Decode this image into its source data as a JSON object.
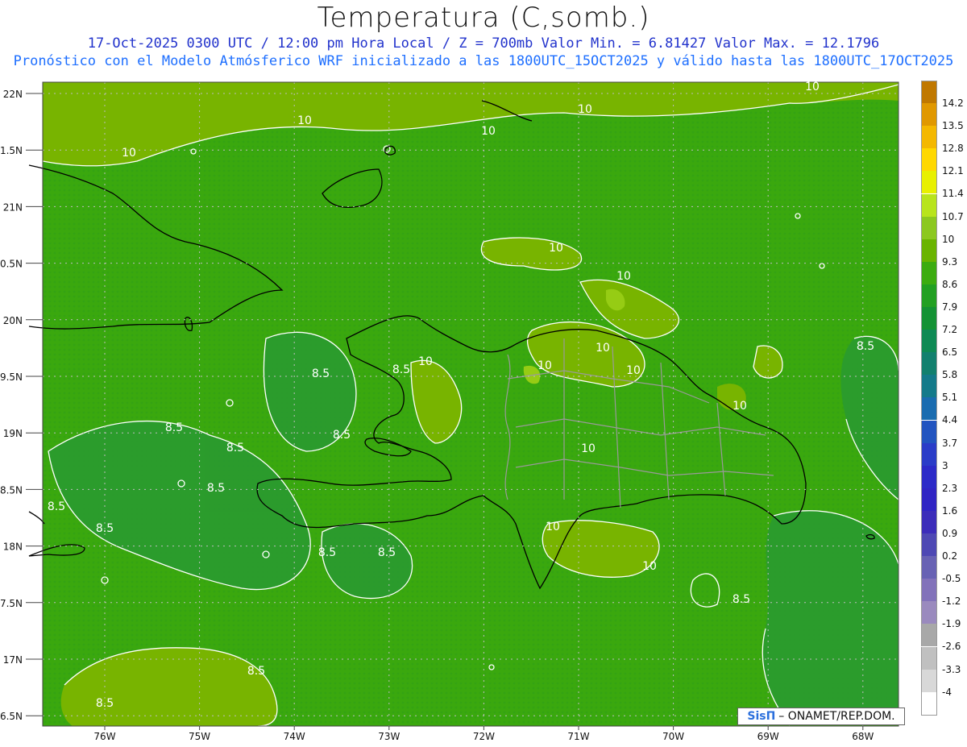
{
  "header": {
    "title": "Temperatura (C,somb.)",
    "line1": "17-Oct-2025  0300 UTC / 12:00 pm Hora Local / Z = 700mb   Valor Min. = 6.81427  Valor Max. = 12.1796",
    "line2": "Pronóstico con el Modelo Atmósferico WRF inicializado a las 1800UTC_15OCT2025 y válido hasta las  1800UTC_17OCT2025"
  },
  "axes": {
    "lat_labels": [
      "22N",
      "1.5N",
      "21N",
      "0.5N",
      "20N",
      "9.5N",
      "19N",
      "8.5N",
      "18N",
      "7.5N",
      "17N",
      "6.5N"
    ],
    "lon_labels": [
      "76W",
      "75W",
      "74W",
      "73W",
      "72W",
      "71W",
      "70W",
      "69W",
      "68W"
    ]
  },
  "colorbar": {
    "levels": [
      "14.2",
      "13.5",
      "12.8",
      "12.1",
      "11.4",
      "10.7",
      "10",
      "9.3",
      "8.6",
      "7.9",
      "7.2",
      "6.5",
      "5.8",
      "5.1",
      "4.4",
      "3.7",
      "3",
      "2.3",
      "1.6",
      "0.9",
      "0.2",
      "-0.5",
      "-1.2",
      "-1.9",
      "-2.6",
      "-3.3",
      "-4"
    ],
    "colors": [
      "#c07800",
      "#e09800",
      "#f4b800",
      "#ffd800",
      "#e8f000",
      "#b8e41c",
      "#8cc820",
      "#6ab400",
      "#3cac10",
      "#22a022",
      "#149234",
      "#0e8a54",
      "#12806e",
      "#147a8a",
      "#1a6cb0",
      "#2254c0",
      "#2a3cc8",
      "#2c2ac8",
      "#3024c4",
      "#3c2cba",
      "#4e48b4",
      "#6862b4",
      "#8272ba",
      "#9a8abe",
      "#a8a8a8",
      "#c0c0c0",
      "#d8d8d8",
      "#ffffff"
    ]
  },
  "contour_labels": [
    "10",
    "10",
    "10",
    "10",
    "10",
    "10",
    "10",
    "10",
    "10",
    "10",
    "10",
    "10",
    "10",
    "10",
    "10",
    "8.5",
    "8.5",
    "8.5",
    "8.5",
    "8.5",
    "8.5",
    "8.5",
    "8.5",
    "8.5",
    "8.5",
    "8.5",
    "8.5",
    "8.5",
    "8.5"
  ],
  "credit": {
    "logo": "SisΠ",
    "text": "– ONAMET/REP.DOM."
  }
}
